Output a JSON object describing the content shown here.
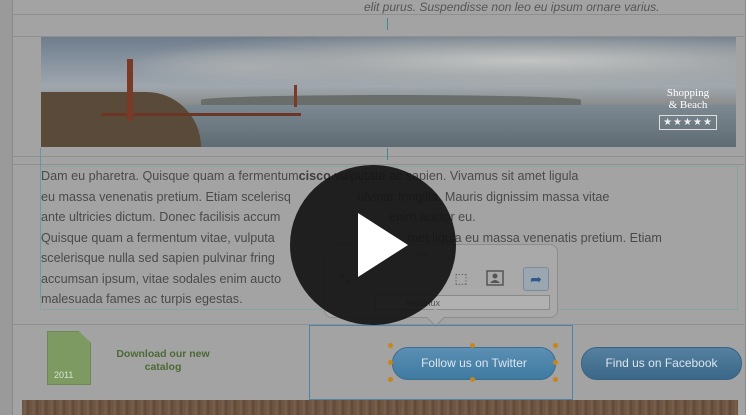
{
  "top_text": "elit purus. Suspendisse non leo eu ipsum ornare varius.",
  "banner": {
    "badge_line1": "Shopping",
    "badge_line2": "& Beach",
    "badge_stars": "★★★★★"
  },
  "body": {
    "para1_before": "Dam eu pharetra. Quisque quam  a fermentum",
    "para1_bold": "cisco",
    "para1_after": " vulputate ac sapien. Vivamus sit amet ligula",
    "line2": "eu massa venenatis pretium. Etiam scelerisq                   ulvinar fringilla. Mauris dignissim massa vitae",
    "line3": "ante ultricies dictum. Donec facilisis accum                               enim auctor eu.",
    "line4": "Quisque quam a fermentum vitae, vulputa                                      met ligula eu massa venenatis pretium. Etiam",
    "line5": "scelerisque nulla sed sapien pulvinar fring                                       ies dictum. Donec facilisis",
    "line6": "accumsan ipsum, vitae sodales enim aucto                                          senectus et netus et",
    "line7": "malesuada fames ac turpis egestas."
  },
  "popover": {
    "title": "rea",
    "url": "/equinux"
  },
  "footer": {
    "catalog_year": "2011",
    "catalog_text": "Download our new catalog",
    "twitter_button": "Follow us on Twitter",
    "facebook_button": "Find us on Facebook"
  },
  "icons": {
    "play": "play-icon",
    "redo": "redo-arrow-icon",
    "image": "image-icon"
  },
  "colors": {
    "twitter": "#4a84ab",
    "facebook": "#46718f",
    "catalog_text": "#4b6a36",
    "selection": "#4e84a8",
    "handle": "#c7851c"
  }
}
